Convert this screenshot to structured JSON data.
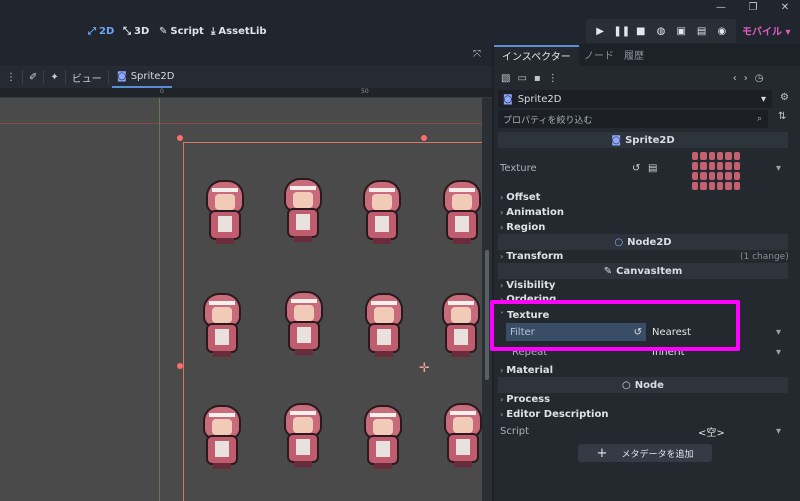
{
  "window": {
    "minimize": "—",
    "maximize": "❐",
    "close": "✕"
  },
  "workspace": {
    "btn_2d": "2D",
    "btn_3d": "3D",
    "btn_script": "Script",
    "btn_assetlib": "AssetLib"
  },
  "renderer": {
    "label": "モバイル"
  },
  "viewport_toolbar": {
    "view_label": "ビュー",
    "scene_tab": "Sprite2D"
  },
  "ruler": {
    "tick0": "0",
    "tick50": "50"
  },
  "dock": {
    "tabs": [
      "インスペクター",
      "ノード",
      "履歴"
    ],
    "node_path": "Sprite2D",
    "filter_placeholder": "プロパティを絞り込む",
    "sections": {
      "sprite2d": "Sprite2D",
      "node2d": "Node2D",
      "canvasitem": "CanvasItem",
      "node": "Node"
    },
    "props": {
      "texture": "Texture",
      "offset": "Offset",
      "animation": "Animation",
      "region": "Region",
      "transform": "Transform",
      "transform_note": "(1 change)",
      "visibility": "Visibility",
      "ordering": "Ordering",
      "texture_group": "Texture",
      "filter": "Filter",
      "filter_value": "Nearest",
      "repeat": "Repeat",
      "repeat_value": "Inherit",
      "material": "Material",
      "process": "Process",
      "editor_description": "Editor Description",
      "script": "Script",
      "script_value": "<空>",
      "add_metadata": "メタデータを追加"
    }
  },
  "colors": {
    "highlight": "#ff00ff",
    "accent": "#6ea6f6",
    "renderer": "#e05ec1"
  }
}
